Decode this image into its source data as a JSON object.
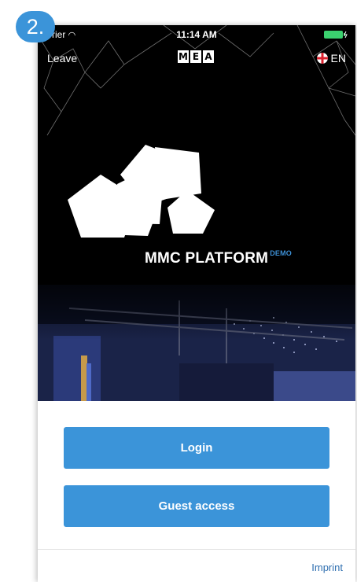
{
  "step_badge": "2.",
  "status": {
    "carrier": "rrier",
    "time": "11:14 AM"
  },
  "nav": {
    "leave": "Leave",
    "logo_letters": [
      "M",
      "E",
      "A"
    ],
    "language": "EN"
  },
  "brand": {
    "name": "MMC PLATFORM",
    "tag": "DEMO"
  },
  "actions": {
    "login": "Login",
    "guest": "Guest access"
  },
  "footer": {
    "imprint": "Imprint"
  },
  "colors": {
    "accent": "#3b94d9",
    "link": "#2f6fb0",
    "hero_bg": "#000000"
  }
}
